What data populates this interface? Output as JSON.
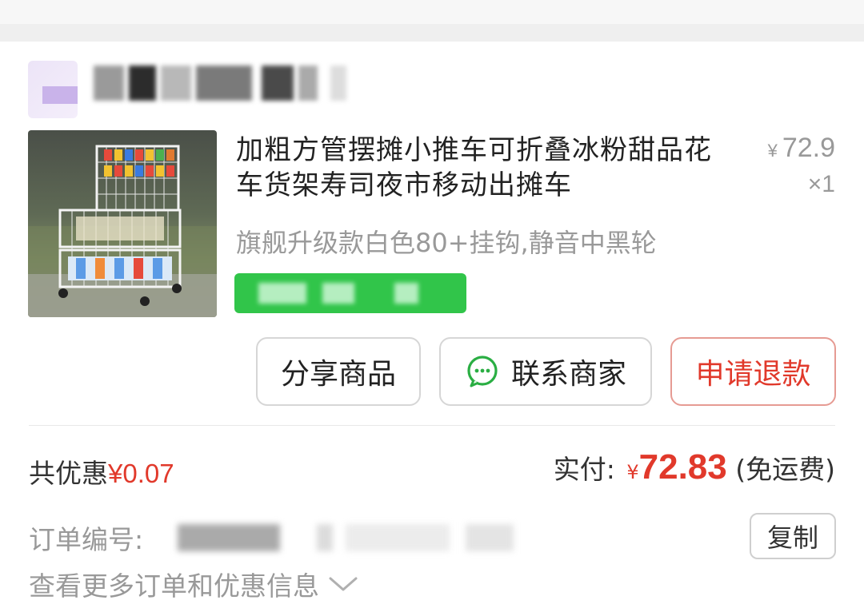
{
  "order": {
    "product": {
      "title": "加粗方管摆摊小推车可折叠冰粉甜品花车货架寿司夜市移动出摊车",
      "spec": "旗舰升级款白色80+挂钩,静音中黑轮",
      "unit_price_symbol": "¥",
      "unit_price": "72.9",
      "quantity": "×1"
    },
    "actions": {
      "share_label": "分享商品",
      "contact_label": "联系商家",
      "refund_label": "申请退款"
    },
    "summary": {
      "discount_prefix": "共优惠",
      "discount_amount": "¥0.07",
      "paid_label": "实付:",
      "paid_symbol": "¥",
      "paid_amount": "72.83",
      "shipping_note": "(免运费)"
    },
    "order_info": {
      "order_no_label": "订单编号:",
      "copy_label": "复制",
      "more_label": "查看更多订单和优惠信息"
    }
  },
  "colors": {
    "accent_red": "#e1392b",
    "promo_green": "#31c54a",
    "wechat_green": "#2aae43"
  },
  "icons": {
    "chat": "chat-bubble-icon",
    "more": "chevron-down-icon"
  }
}
